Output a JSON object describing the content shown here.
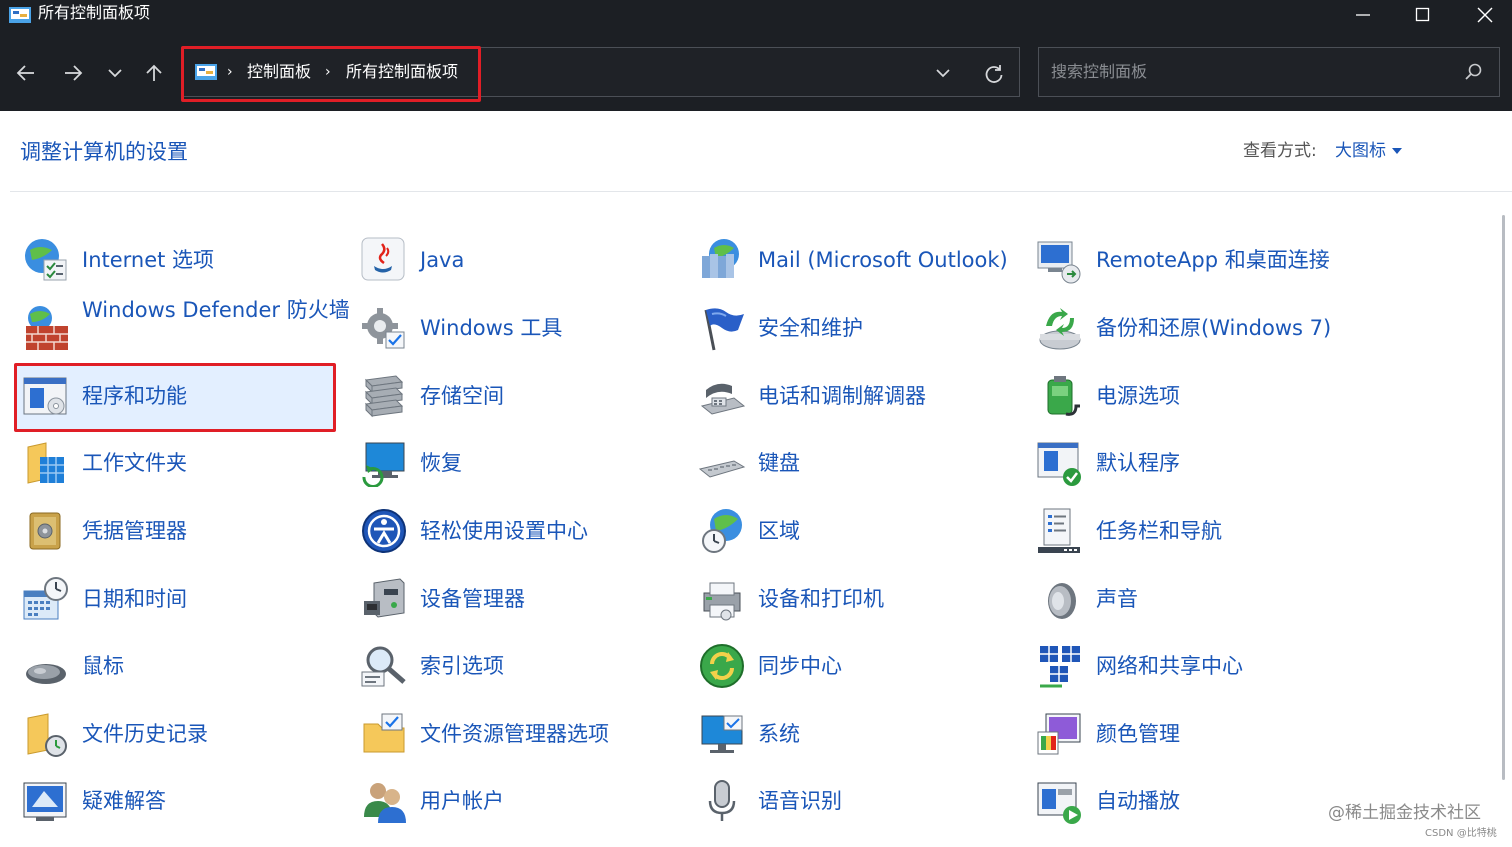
{
  "window": {
    "title": "所有控制面板项"
  },
  "address": {
    "crumbs": [
      "控制面板",
      "所有控制面板项"
    ],
    "separator": "›"
  },
  "search": {
    "placeholder": "搜索控制面板"
  },
  "header": {
    "title": "调整计算机的设置",
    "view_label": "查看方式:",
    "view_value": "大图标"
  },
  "items": [
    {
      "label": "Internet 选项",
      "icon": "internet-options-icon"
    },
    {
      "label": "Java",
      "icon": "java-icon"
    },
    {
      "label": "Mail (Microsoft Outlook)",
      "icon": "mail-icon"
    },
    {
      "label": "RemoteApp 和桌面连接",
      "icon": "remoteapp-icon"
    },
    {
      "label": "Windows Defender 防火墙",
      "icon": "firewall-icon"
    },
    {
      "label": "Windows 工具",
      "icon": "windows-tools-icon"
    },
    {
      "label": "安全和维护",
      "icon": "security-flag-icon"
    },
    {
      "label": "备份和还原(Windows 7)",
      "icon": "backup-icon"
    },
    {
      "label": "程序和功能",
      "icon": "programs-icon",
      "selected": true
    },
    {
      "label": "存储空间",
      "icon": "storage-icon"
    },
    {
      "label": "电话和调制解调器",
      "icon": "phone-modem-icon"
    },
    {
      "label": "电源选项",
      "icon": "power-icon"
    },
    {
      "label": "工作文件夹",
      "icon": "work-folders-icon"
    },
    {
      "label": "恢复",
      "icon": "recovery-icon"
    },
    {
      "label": "键盘",
      "icon": "keyboard-icon"
    },
    {
      "label": "默认程序",
      "icon": "default-programs-icon"
    },
    {
      "label": "凭据管理器",
      "icon": "credential-icon"
    },
    {
      "label": "轻松使用设置中心",
      "icon": "ease-of-access-icon"
    },
    {
      "label": "区域",
      "icon": "region-icon"
    },
    {
      "label": "任务栏和导航",
      "icon": "taskbar-icon"
    },
    {
      "label": "日期和时间",
      "icon": "date-time-icon"
    },
    {
      "label": "设备管理器",
      "icon": "device-manager-icon"
    },
    {
      "label": "设备和打印机",
      "icon": "printer-icon"
    },
    {
      "label": "声音",
      "icon": "sound-icon"
    },
    {
      "label": "鼠标",
      "icon": "mouse-icon"
    },
    {
      "label": "索引选项",
      "icon": "indexing-icon"
    },
    {
      "label": "同步中心",
      "icon": "sync-icon"
    },
    {
      "label": "网络和共享中心",
      "icon": "network-icon"
    },
    {
      "label": "文件历史记录",
      "icon": "file-history-icon"
    },
    {
      "label": "文件资源管理器选项",
      "icon": "explorer-options-icon"
    },
    {
      "label": "系统",
      "icon": "system-icon"
    },
    {
      "label": "颜色管理",
      "icon": "color-management-icon"
    },
    {
      "label": "疑难解答",
      "icon": "troubleshoot-icon"
    },
    {
      "label": "用户帐户",
      "icon": "user-accounts-icon"
    },
    {
      "label": "语音识别",
      "icon": "speech-icon"
    },
    {
      "label": "自动播放",
      "icon": "autoplay-icon"
    }
  ],
  "watermark": {
    "main": "@稀土掘金技术社区",
    "sub": "CSDN @比特桃"
  },
  "colors": {
    "chrome": "#1c1f24",
    "link": "#1a56b8",
    "highlight": "#e01e26",
    "selected_bg": "#e3efff"
  }
}
